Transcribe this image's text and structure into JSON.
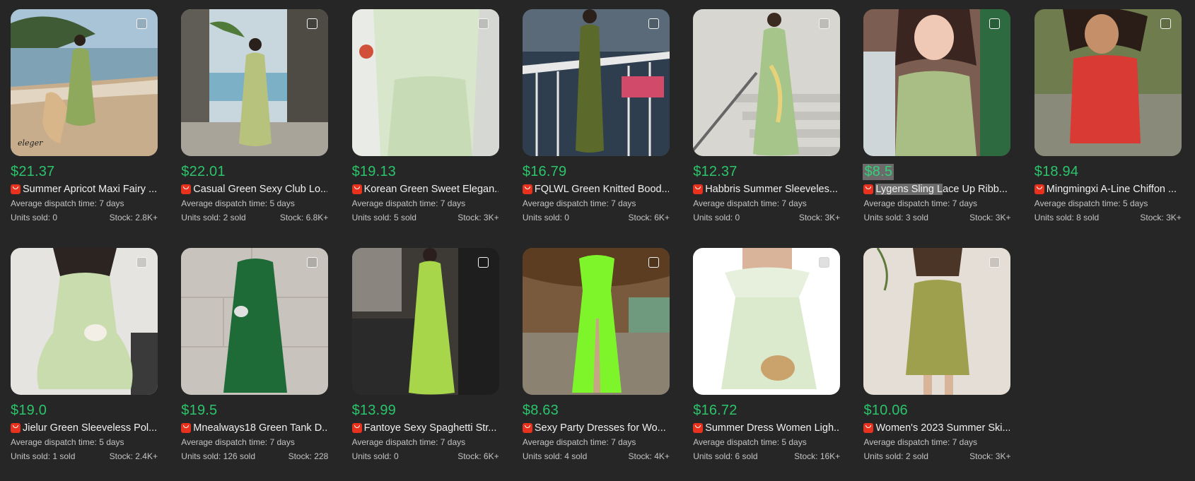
{
  "labels": {
    "dispatch_prefix": "Average dispatch time: ",
    "units_prefix": "Units sold: ",
    "stock_prefix": "Stock: "
  },
  "icons": {
    "store": "store-badge-icon",
    "select": "select-checkbox"
  },
  "colors": {
    "price": "#2bc46b",
    "store_badge": "#e8321e",
    "background": "#262626"
  },
  "products": [
    {
      "price": "$21.37",
      "title": "Summer Apricot Maxi Fairy ...",
      "dispatch": "7 days",
      "units": "0",
      "stock": "2.8K+",
      "watermark": "eleger"
    },
    {
      "price": "$22.01",
      "title": "Casual Green Sexy Club Lo...",
      "dispatch": "5 days",
      "units": "2 sold",
      "stock": "6.8K+"
    },
    {
      "price": "$19.13",
      "title": "Korean Green Sweet Elegan...",
      "dispatch": "7 days",
      "units": "5 sold",
      "stock": "3K+"
    },
    {
      "price": "$16.79",
      "title": "FQLWL Green Knitted Bood...",
      "dispatch": "7 days",
      "units": "0",
      "stock": "6K+"
    },
    {
      "price": "$12.37",
      "title": "Habbris Summer Sleeveles...",
      "dispatch": "7 days",
      "units": "0",
      "stock": "3K+"
    },
    {
      "price": "$8.5",
      "title": "Lygens Sling Lace Up Ribb...",
      "title_highlight": "Lygens Sling L",
      "title_rest": "ace Up Ribb...",
      "dispatch": "7 days",
      "units": "3 sold",
      "stock": "3K+",
      "selected": true
    },
    {
      "price": "$18.94",
      "title": "Mingmingxi A-Line Chiffon ...",
      "dispatch": "5 days",
      "units": "8 sold",
      "stock": "3K+"
    },
    {
      "price": "$19.0",
      "title": "Jielur Green Sleeveless Pol...",
      "dispatch": "5 days",
      "units": "1 sold",
      "stock": "2.4K+"
    },
    {
      "price": "$19.5",
      "title": "Mnealways18 Green Tank D...",
      "dispatch": "7 days",
      "units": "126 sold",
      "stock": "228"
    },
    {
      "price": "$13.99",
      "title": "Fantoye Sexy Spaghetti Str...",
      "dispatch": "7 days",
      "units": "0",
      "stock": "6K+"
    },
    {
      "price": "$8.63",
      "title": "Sexy Party Dresses for Wo...",
      "dispatch": "7 days",
      "units": "4 sold",
      "stock": "4K+"
    },
    {
      "price": "$16.72",
      "title": "Summer Dress Women Ligh...",
      "dispatch": "5 days",
      "units": "6 sold",
      "stock": "16K+"
    },
    {
      "price": "$10.06",
      "title": "Women's 2023 Summer Ski...",
      "dispatch": "7 days",
      "units": "2 sold",
      "stock": "3K+"
    }
  ]
}
